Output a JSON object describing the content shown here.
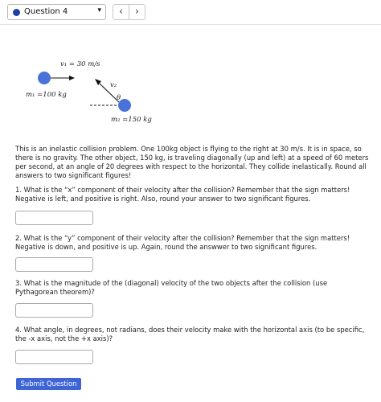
{
  "nav": {
    "question_select_value": "Question 4",
    "prev_glyph": "‹",
    "next_glyph": "›",
    "caret_glyph": "▾"
  },
  "diagram": {
    "v1_label": "v₁ = 30 m/s",
    "v2_label": "v₂",
    "theta_label": "θ",
    "m1_label": "m₁ =100 kg",
    "m2_label": "m₂ =150 kg"
  },
  "problem": {
    "intro": "This is an inelastic collision problem. One 100kg object is flying to the right at 30 m/s. It is in space, so there is no gravity. The other object, 150 kg, is traveling diagonally (up and left) at a speed of 60 meters per second, at an angle of 20 degrees with respect to the horizontal. They collide inelastically. Round all answers to two significant figures!",
    "questions": [
      "1. What is the “x” component of their velocity after the collision? Remember that the sign matters! Negative is left, and positive is right. Also, round your answer to two significant figures.",
      "2. What is the “y” component of their velocity after the collision? Remember that the sign matters! Negative is down, and positive is up. Again, round the answwer to two significant figures.",
      "3. What is the magnitude of the (diagonal) velocity of the two objects after the collision (use Pythagorean theorem)?",
      "4. What angle, in degrees, not radians, does their velocity make with the horizontal axis (to be specific, the -x axis, not the +x axis)?"
    ],
    "answers": [
      "",
      "",
      "",
      ""
    ]
  },
  "submit_label": "Submit Question",
  "colors": {
    "accent": "#3e64d6",
    "ball": "#4a72d8",
    "dot": "#1f3fa8"
  }
}
